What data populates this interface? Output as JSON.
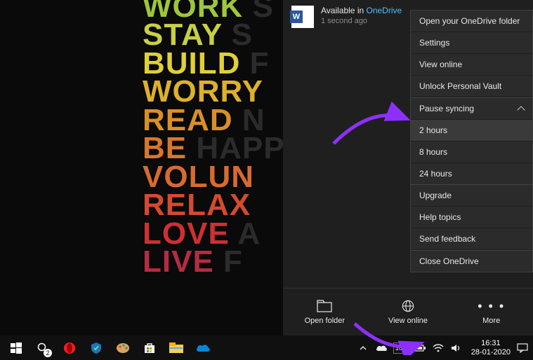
{
  "wallpaper": {
    "lines": [
      {
        "main": "WORK",
        "faint": " S",
        "color": "#9ec63c"
      },
      {
        "main": "STAY",
        "faint": " S",
        "color": "#c7d042"
      },
      {
        "main": "BUILD",
        "faint": " F",
        "color": "#e0cf37"
      },
      {
        "main": "WORRY",
        "faint": "",
        "color": "#ddb12a"
      },
      {
        "main": "READ",
        "faint": " N",
        "color": "#d98f27"
      },
      {
        "main": "BE",
        "faint": " HAPP",
        "color": "#d8772a"
      },
      {
        "main": "VOLUN",
        "faint": "",
        "color": "#d86a2e"
      },
      {
        "main": "RELAX",
        "faint": "",
        "color": "#d54a2e"
      },
      {
        "main": "LOVE",
        "faint": " A",
        "color": "#cf2f33"
      },
      {
        "main": "LIVE",
        "faint": " F",
        "color": "#b42c44"
      }
    ]
  },
  "onedrive": {
    "header": {
      "available_prefix": "Available in ",
      "service_link": "OneDrive",
      "subtext": "1 second ago"
    },
    "menu": {
      "open_folder": "Open your OneDrive folder",
      "settings": "Settings",
      "view_online": "View online",
      "unlock_vault": "Unlock Personal Vault",
      "pause_syncing": "Pause syncing",
      "pause_options": {
        "h2": "2 hours",
        "h8": "8 hours",
        "h24": "24 hours"
      },
      "upgrade": "Upgrade",
      "help_topics": "Help topics",
      "send_feedback": "Send feedback",
      "close": "Close OneDrive"
    },
    "actions": {
      "open_folder": "Open folder",
      "view_online": "View online",
      "more": "More"
    }
  },
  "taskbar": {
    "battery_pct": "100",
    "time": "16:31",
    "date": "28-01-2020",
    "search_badge": "2"
  }
}
